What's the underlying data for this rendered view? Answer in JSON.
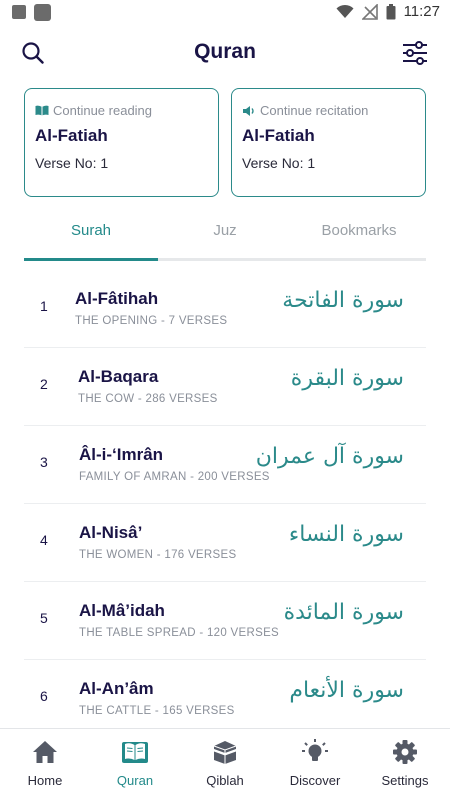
{
  "status_bar": {
    "time": "11:27"
  },
  "header": {
    "title": "Quran"
  },
  "continue_reading": {
    "label": "Continue reading",
    "surah": "Al-Fatiah",
    "verse": "Verse No: 1"
  },
  "continue_recitation": {
    "label": "Continue recitation",
    "surah": "Al-Fatiah",
    "verse": "Verse No: 1"
  },
  "tabs": [
    {
      "label": "Surah",
      "active": true
    },
    {
      "label": "Juz",
      "active": false
    },
    {
      "label": "Bookmarks",
      "active": false
    }
  ],
  "surahs": [
    {
      "number": "1",
      "name": "Al-Fâtihah",
      "subtitle": "THE OPENING - 7 VERSES",
      "arabic": "سورة الفاتحة"
    },
    {
      "number": "2",
      "name": "Al-Baqara",
      "subtitle": "THE COW - 286 VERSES",
      "arabic": "سورة البقرة"
    },
    {
      "number": "3",
      "name": "Âl-i-‘Imrân",
      "subtitle": "FAMILY OF AMRAN - 200 VERSES",
      "arabic": "سورة آل عمران"
    },
    {
      "number": "4",
      "name": "Al-Nisâ’",
      "subtitle": "THE WOMEN - 176 VERSES",
      "arabic": "سورة النساء"
    },
    {
      "number": "5",
      "name": "Al-Mâ’idah",
      "subtitle": "THE TABLE SPREAD - 120 VERSES",
      "arabic": "سورة المائدة"
    },
    {
      "number": "6",
      "name": "Al-An’âm",
      "subtitle": "THE CATTLE - 165 VERSES",
      "arabic": "سورة الأنعام"
    }
  ],
  "bottom_nav": [
    {
      "label": "Home",
      "icon": "home-icon",
      "active": false
    },
    {
      "label": "Quran",
      "icon": "book-icon",
      "active": true
    },
    {
      "label": "Qiblah",
      "icon": "kaaba-icon",
      "active": false
    },
    {
      "label": "Discover",
      "icon": "lightbulb-icon",
      "active": false
    },
    {
      "label": "Settings",
      "icon": "gear-icon",
      "active": false
    }
  ],
  "colors": {
    "accent": "#238a8a",
    "title": "#1a1446",
    "muted": "#8a8f99"
  }
}
